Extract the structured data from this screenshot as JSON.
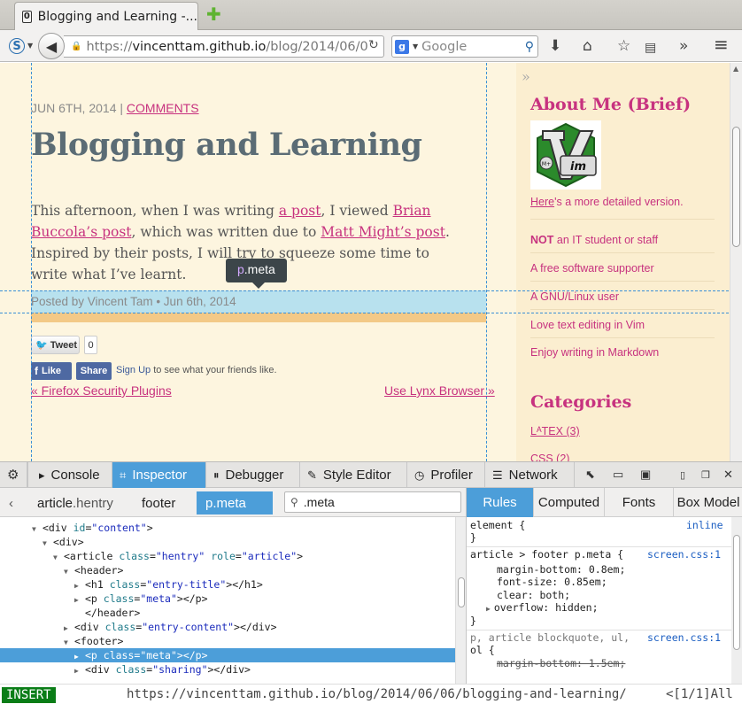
{
  "browser": {
    "tab_title": "Blogging and Learning -...",
    "tab_favicon": "0",
    "url_prefix": "https://",
    "url_domain": "vincenttam.github.io",
    "url_rest": "/blog/2014/06/0",
    "search_engine_label": "g",
    "search_placeholder": "Google"
  },
  "article": {
    "date": "JUN 6TH, 2014",
    "date_sep": " | ",
    "comments_label": "COMMENTS",
    "title": "Blogging and Learning",
    "p_1": "This afternoon, when I was writing ",
    "link_post": "a post",
    "p_2": ", I viewed ",
    "link_brian": "Brian Buccola’s post",
    "p_3": ", which was written due to ",
    "link_matt": "Matt Might’s post",
    "p_4": ". Inspired by their posts, I will try to squeeze some time to write what I’ve learnt.",
    "meta": "Posted by Vincent Tam  • Jun 6th, 2014",
    "tweet_label": "Tweet",
    "tweet_count": "0",
    "fb_like": "Like",
    "fb_share": "Share",
    "fb_signup_link": "Sign Up",
    "fb_signup_text": " to see what your friends like.",
    "prev_link": "« Firefox Security Plugins",
    "next_link": "Use Lynx Browser »"
  },
  "tooltip": {
    "tag": "p",
    "cls": ".meta"
  },
  "sidebar": {
    "about_heading": "About Me (Brief)",
    "here_link": "Here",
    "here_text": "'s a more detailed version.",
    "not_bold": "NOT",
    "not_rest": " an IT student or staff",
    "items": [
      "A free software supporter",
      "A GNU/Linux user",
      "Love text editing in Vim",
      "Enjoy writing in Markdown"
    ],
    "categories_heading": "Categories",
    "cat_latex": "LᴬTEX (3)",
    "cat_css": "CSS (2)"
  },
  "devtools": {
    "tabs": [
      "Console",
      "Inspector",
      "Debugger",
      "Style Editor",
      "Profiler",
      "Network"
    ],
    "active_tab": "Inspector",
    "crumbs": [
      {
        "tag": "article",
        "cls": ".hentry"
      },
      {
        "tag": "footer",
        "cls": ""
      },
      {
        "tag": "p",
        "cls": ".meta"
      }
    ],
    "find_value": ".meta",
    "markup": [
      "<div id=\"content\">",
      "<div>",
      "<article class=\"hentry\" role=\"article\">",
      "<header>",
      "<h1 class=\"entry-title\"></h1>",
      "<p class=\"meta\"></p>",
      "</header>",
      "<div class=\"entry-content\"></div>",
      "<footer>",
      "<p class=\"meta\"></p>",
      "<div class=\"sharing\"></div>"
    ],
    "side_tabs": [
      "Rules",
      "Computed",
      "Fonts",
      "Box Model"
    ],
    "rules": {
      "element_sel": "element {",
      "element_src": "inline",
      "close": "}",
      "r1_sel": "article > footer p.meta {",
      "r1_src": "screen.css:1",
      "r1_p1": "margin-bottom: 0.8em;",
      "r1_p2": "font-size: 0.85em;",
      "r1_p3": "clear: both;",
      "r1_p4": "overflow: hidden;",
      "r2_sel1": "p, article blockquote, ul,",
      "r2_sel2": "ol {",
      "r2_src": "screen.css:1",
      "r2_p1": "margin-bottom: 1.5em;"
    }
  },
  "statusbar": {
    "mode": "INSERT",
    "url": "https://vincenttam.github.io/blog/2014/06/06/blogging-and-learning/",
    "position": "<[1/1]All"
  }
}
